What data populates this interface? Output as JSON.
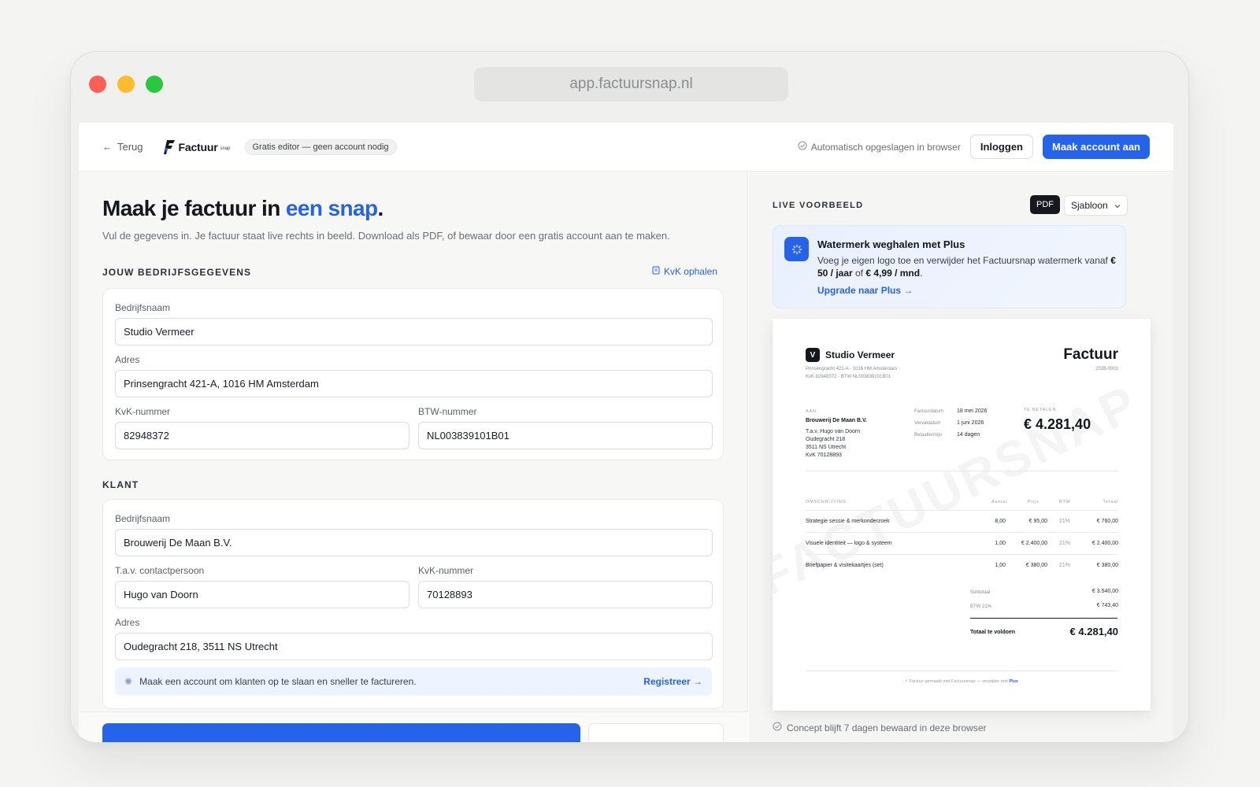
{
  "browser": {
    "url": "app.factuursnap.nl"
  },
  "header": {
    "back_label": "Terug",
    "logo_text": "Factuur",
    "logo_sub": "snap",
    "badge": "Gratis editor — geen account nodig",
    "autosave": "Automatisch opgeslagen in browser",
    "login_label": "Inloggen",
    "signup_label": "Maak account aan"
  },
  "editor": {
    "headline_pre": "Maak je factuur in ",
    "headline_accent": "een snap",
    "headline_post": ".",
    "subtext": "Vul de gegevens in. Je factuur staat live rechts in beeld. Download als PDF, of bewaar door een gratis account aan te maken.",
    "company_section": "JOUW BEDRIJFSGEGEVENS",
    "kvk_link": "KvK ophalen",
    "company": {
      "name_label": "Bedrijfsnaam",
      "name_value": "Studio Vermeer",
      "address_label": "Adres",
      "address_value": "Prinsengracht 421-A, 1016 HM Amsterdam",
      "kvk_label": "KvK-nummer",
      "kvk_value": "82948372",
      "btw_label": "BTW-nummer",
      "btw_value": "NL003839101B01"
    },
    "client_section": "KLANT",
    "client": {
      "name_label": "Bedrijfsnaam",
      "name_value": "Brouwerij De Maan B.V.",
      "contact_label": "T.a.v. contactpersoon",
      "contact_value": "Hugo van Doorn",
      "kvk_label": "KvK-nummer",
      "kvk_value": "70128893",
      "address_label": "Adres",
      "address_value": "Oudegracht 218, 3511 NS Utrecht"
    },
    "notice_text": "Maak een account om klanten op te slaan en sneller te factureren.",
    "notice_link": "Registreer →"
  },
  "preview": {
    "title": "LIVE VOORBEELD",
    "pdf_tag": "PDF",
    "template_label": "Sjabloon",
    "promo": {
      "title": "Watermerk weghalen met Plus",
      "text_pre": "Voeg je eigen logo toe en verwijder het Factuursnap watermerk vanaf ",
      "price_year": "€ 50 / jaar",
      "text_mid": " of ",
      "price_month": "€ 4,99 / mnd",
      "text_post": ".",
      "link": "Upgrade naar Plus →"
    },
    "invoice": {
      "logo_letter": "V",
      "company": "Studio Vermeer",
      "company_line1": "Prinsengracht 421-A · 1016 HM Amsterdam",
      "company_line2": "KvK 82948372 · BTW NL003839101B01",
      "title": "Factuur",
      "number": "2026-0001",
      "to_label": "AAN",
      "client_name": "Brouwerij De Maan B.V.",
      "client_lines": [
        "T.a.v. Hugo van Doorn",
        "Oudegracht 218",
        "3511 NS Utrecht",
        "KvK 70128893"
      ],
      "meta": [
        {
          "label": "Factuurdatum",
          "value": "18 mei 2026"
        },
        {
          "label": "Vervaldatum",
          "value": "1 juni 2026"
        },
        {
          "label": "Betaaltermijn",
          "value": "14 dagen"
        }
      ],
      "due_label": "TE BETALEN",
      "due_amount": "€ 4.281,40",
      "columns": [
        "OMSCHRIJVING",
        "Aantal",
        "Prijs",
        "BTW",
        "Totaal"
      ],
      "rows": [
        {
          "desc": "Strategie sessie & merkonderzoek",
          "qty": "8,00",
          "price": "€ 95,00",
          "btw": "21%",
          "total": "€ 760,00"
        },
        {
          "desc": "Visuele identiteit — logo & systeem",
          "qty": "1,00",
          "price": "€ 2.400,00",
          "btw": "21%",
          "total": "€ 2.400,00"
        },
        {
          "desc": "Briefpapier & visitekaartjes (set)",
          "qty": "1,00",
          "price": "€ 380,00",
          "btw": "21%",
          "total": "€ 380,00"
        }
      ],
      "subtotal_label": "Subtotaal",
      "subtotal": "€ 3.540,00",
      "vat_label": "BTW 21%",
      "vat": "€ 743,40",
      "total_label": "Totaal te voldoen",
      "total": "€ 4.281,40",
      "watermark": "FACTUURSNAP",
      "footer_pre": "Factuur gemaakt met Factuursnap — verwijder met ",
      "footer_plus": "Plus"
    },
    "concept_note": "Concept blijft 7 dagen bewaard in deze browser"
  },
  "colors": {
    "accent": "#2563eb",
    "dark": "#14171d"
  }
}
